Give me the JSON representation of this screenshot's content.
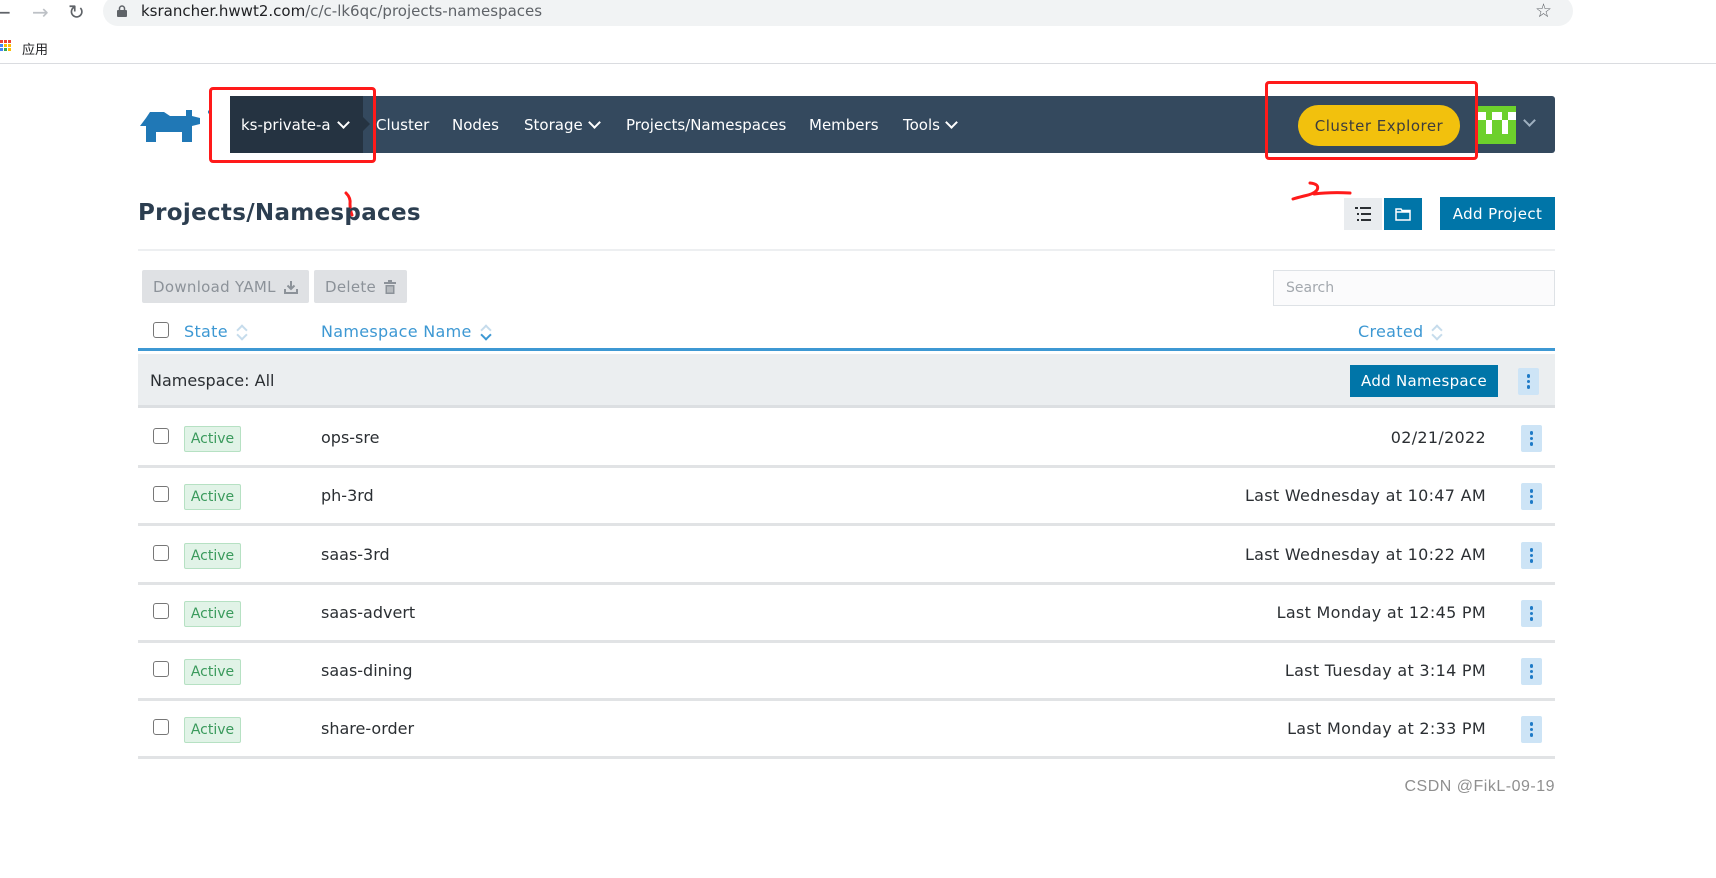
{
  "browser": {
    "url_host": "ksrancher.hwwt2.com",
    "url_path": "/c/c-lk6qc/projects-namespaces",
    "bookmarks_apps_label": "应用"
  },
  "header": {
    "cluster_name": "ks-private-a",
    "nav": [
      {
        "label": "Cluster",
        "dropdown": false
      },
      {
        "label": "Nodes",
        "dropdown": false
      },
      {
        "label": "Storage",
        "dropdown": true
      },
      {
        "label": "Projects/Namespaces",
        "dropdown": false
      },
      {
        "label": "Members",
        "dropdown": false
      },
      {
        "label": "Tools",
        "dropdown": true
      }
    ],
    "cluster_explorer_label": "Cluster Explorer",
    "colors": {
      "nav_bg": "#34495e",
      "cluster_switch_bg": "#253341",
      "explorer_bg": "#f2c10d"
    }
  },
  "page": {
    "title": "Projects/Namespaces",
    "add_project_label": "Add Project",
    "view_list_icon": "list-icon",
    "view_folder_icon": "folder-icon"
  },
  "bulk_actions": {
    "download_yaml_label": "Download YAML",
    "delete_label": "Delete"
  },
  "search": {
    "placeholder": "Search",
    "value": ""
  },
  "table": {
    "columns": {
      "state": "State",
      "name": "Namespace Name",
      "created": "Created"
    },
    "group": {
      "label": "Namespace: All",
      "add_namespace_label": "Add Namespace"
    },
    "rows": [
      {
        "state": "Active",
        "name": "ops-sre",
        "created": "02/21/2022"
      },
      {
        "state": "Active",
        "name": "ph-3rd",
        "created": "Last Wednesday at 10:47 AM"
      },
      {
        "state": "Active",
        "name": "saas-3rd",
        "created": "Last Wednesday at 10:22 AM"
      },
      {
        "state": "Active",
        "name": "saas-advert",
        "created": "Last Monday at 12:45 PM"
      },
      {
        "state": "Active",
        "name": "saas-dining",
        "created": "Last Tuesday at 3:14 PM"
      },
      {
        "state": "Active",
        "name": "share-order",
        "created": "Last Monday at 2:33 PM"
      }
    ]
  },
  "annotations": {
    "mark_1": "1",
    "mark_2": "2",
    "color": "#ff1a1a"
  },
  "watermark": "CSDN @FikL-09-19"
}
